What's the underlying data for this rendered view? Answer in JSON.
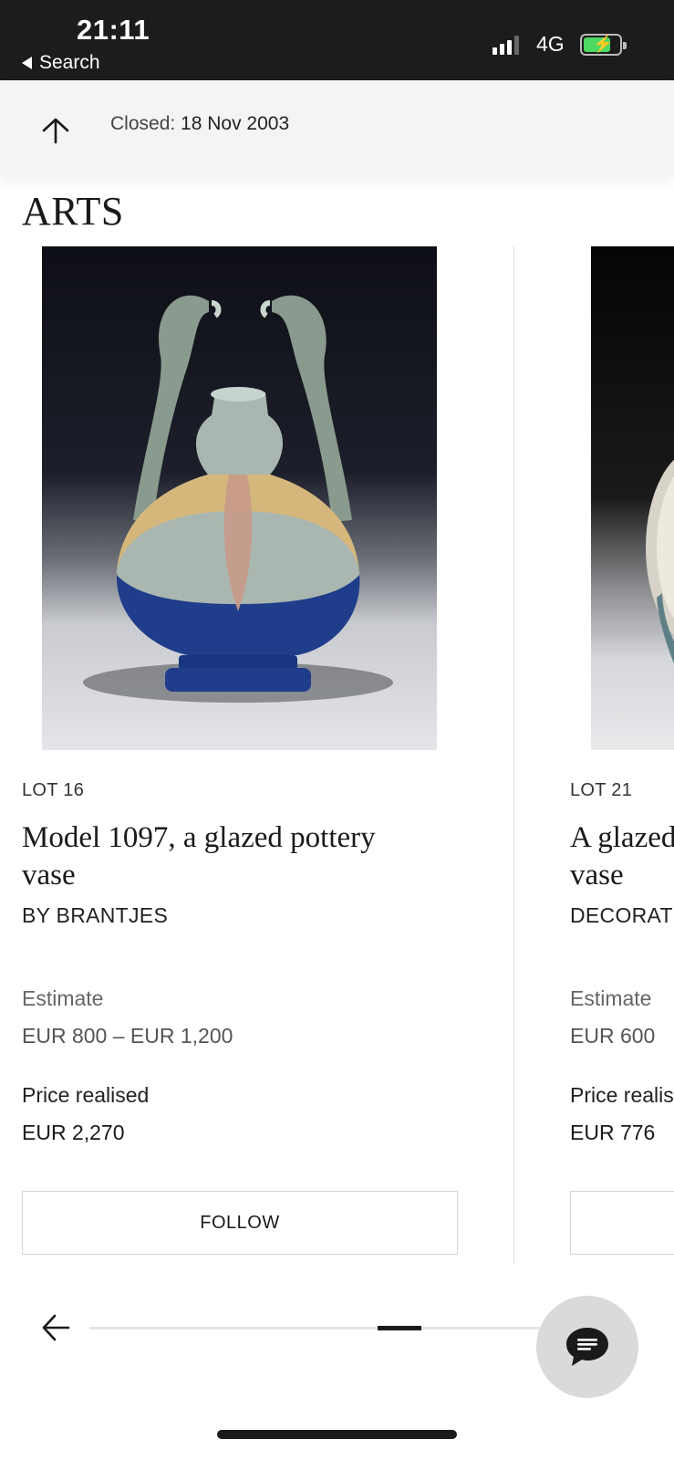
{
  "status_bar": {
    "time": "21:11",
    "back_label": "Search",
    "network": "4G",
    "signal_bars": 3,
    "battery_charging": true
  },
  "header": {
    "icon": "arrow-up-icon",
    "closed_label": "Closed:",
    "closed_date": "18 Nov 2003"
  },
  "section": {
    "title": "ARTS"
  },
  "lots": [
    {
      "lot_number": "LOT 16",
      "title_line1": "Model 1097, a glazed pottery",
      "title_line2": "vase",
      "maker": "BY BRANTJES",
      "estimate_label": "Estimate",
      "estimate_value": "EUR 800 – EUR 1,200",
      "price_label": "Price realised",
      "price_value": "EUR 2,270",
      "follow_label": "FOLLOW"
    },
    {
      "lot_number": "LOT 21",
      "title_line1": "A glazed",
      "title_line2": "vase",
      "maker": "DECORAT",
      "estimate_label": "Estimate",
      "estimate_value": "EUR 600",
      "price_label": "Price realis",
      "price_value": "EUR 776",
      "follow_label": ""
    }
  ],
  "carousel": {
    "back_icon": "arrow-left-icon",
    "progress_fraction": 0.7
  },
  "chat": {
    "icon": "chat-bubble-icon"
  },
  "colors": {
    "status_bar_bg": "#1c1c1c",
    "header_bg": "#f4f4f4",
    "battery_green": "#4cd964",
    "chat_button_bg": "#dadada",
    "vase_blue": "#1f3d8a"
  }
}
